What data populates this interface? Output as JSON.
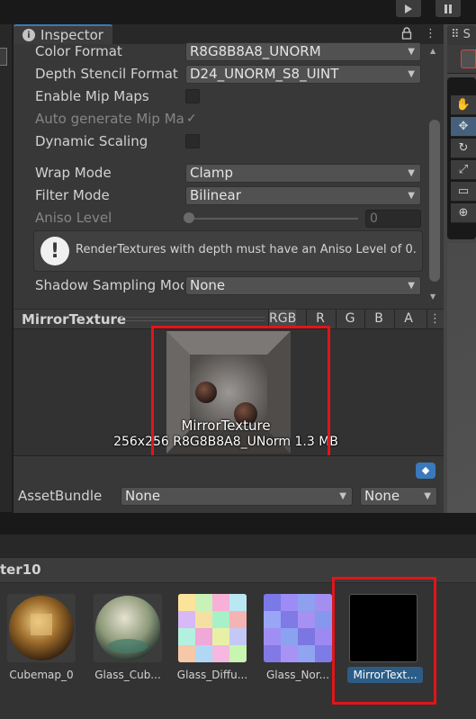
{
  "toolbar": {
    "play_icon": "play-icon",
    "pause_icon": "pause-icon"
  },
  "inspector": {
    "tab_label": "Inspector",
    "rows": [
      {
        "label": "Color Format",
        "value": "R8G8B8A8_UNORM"
      },
      {
        "label": "Depth Stencil Format",
        "value": "D24_UNORM_S8_UINT"
      },
      {
        "label": "Enable Mip Maps"
      },
      {
        "label": "Auto generate Mip Map"
      },
      {
        "label": "Dynamic Scaling"
      },
      {
        "label": "Wrap Mode",
        "value": "Clamp"
      },
      {
        "label": "Filter Mode",
        "value": "Bilinear"
      },
      {
        "label": "Aniso Level",
        "value": "0"
      },
      {
        "label": "Shadow Sampling Moc",
        "value": "None"
      }
    ],
    "auto_mip_checked": true,
    "help_text": "RenderTextures with depth must have an Aniso Level of 0."
  },
  "preview": {
    "title": "MirrorTexture",
    "channels": [
      "RGB",
      "R",
      "G",
      "B",
      "A"
    ],
    "name": "MirrorTexture",
    "info": "256x256  R8G8B8A8_UNorm  1.3 MB"
  },
  "asset_bundle": {
    "label": "AssetBundle",
    "bundle_value": "None",
    "variant_value": "None"
  },
  "scene_tab": {
    "label": "S"
  },
  "project": {
    "path": "ter10",
    "assets": [
      {
        "name": "Cubemap_0"
      },
      {
        "name": "Glass_Cub..."
      },
      {
        "name": "Glass_Diffu..."
      },
      {
        "name": "Glass_Nor..."
      },
      {
        "name": "MirrorText..."
      }
    ]
  },
  "colors": {
    "accent": "#3a79bb",
    "highlight": "#e0151b",
    "selection": "#2c5d87"
  }
}
